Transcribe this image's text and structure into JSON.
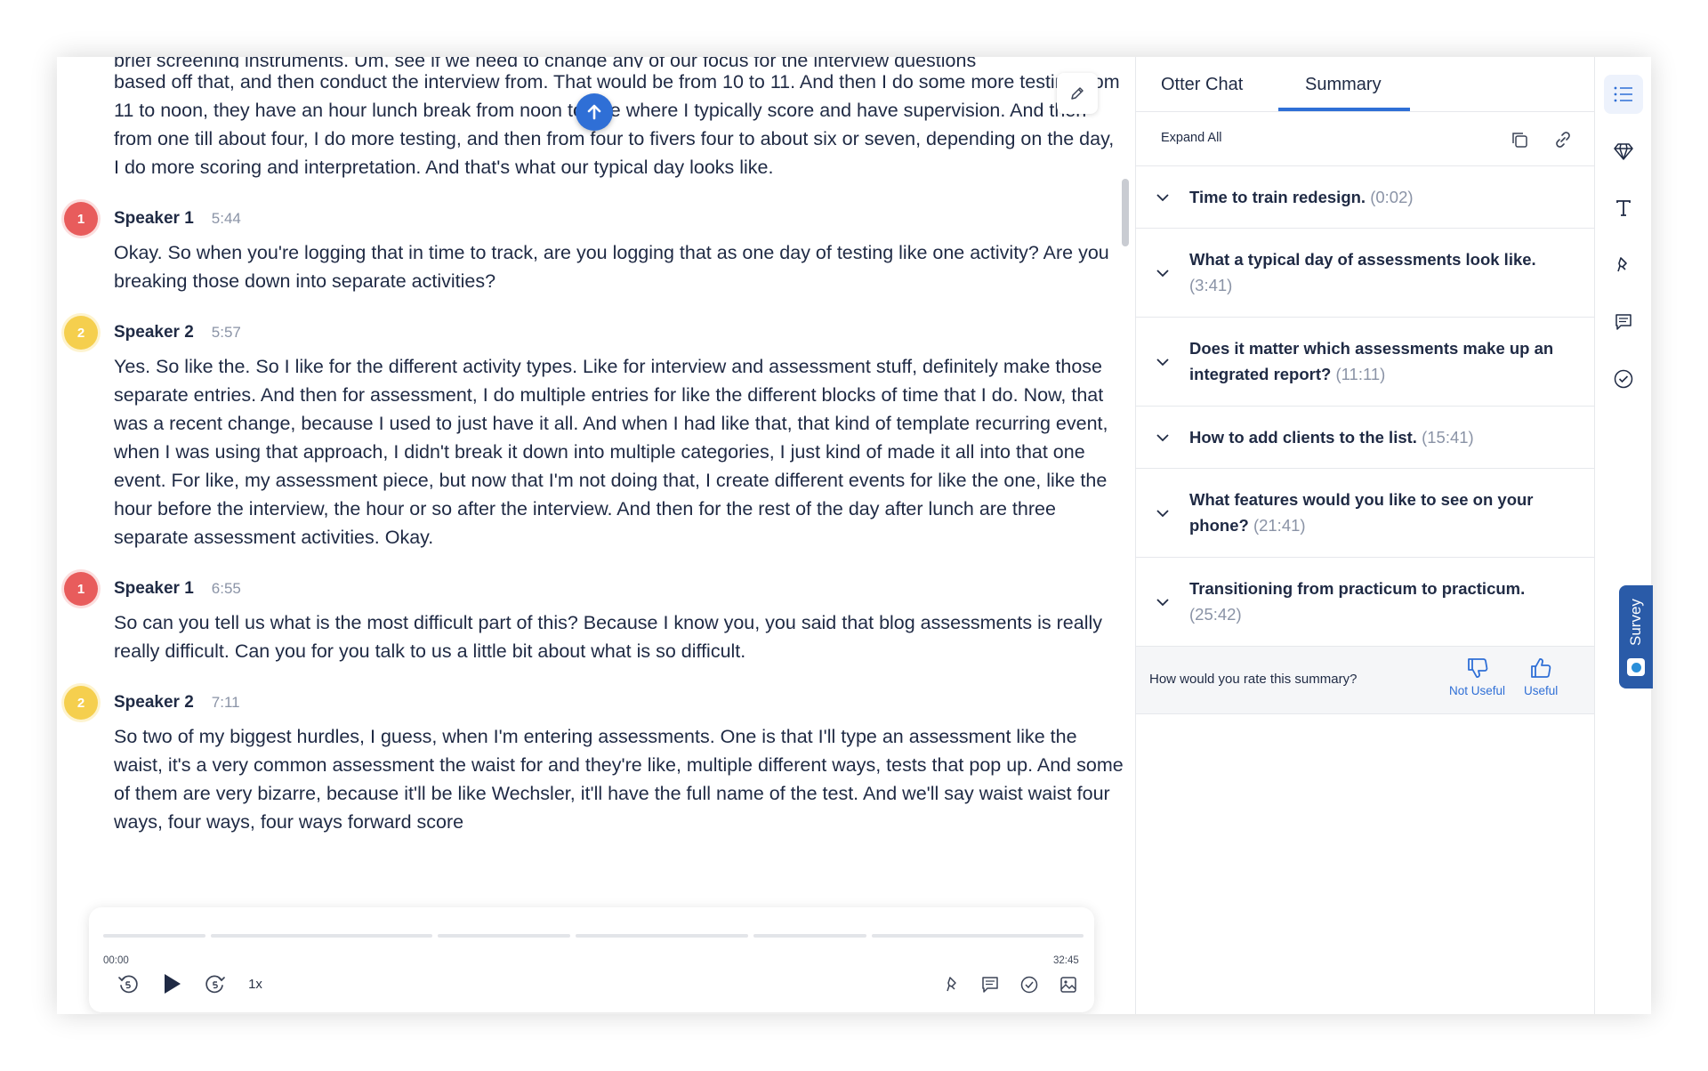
{
  "transcript": {
    "top_partial_line": "brief screening instruments. Um, see if we need to change any of our focus for the interview questions",
    "intro_paragraph": "based off that, and then conduct the interview from. That would be from 10 to 11. And then I do some more testing from 11 to noon, they have an hour lunch break from noon to one where I typically score and have supervision. And then from one till about four, I do more testing, and then from four to fivers four to about six or seven, depending on the day, I do more scoring and interpretation. And that's what our typical day looks like.",
    "blocks": [
      {
        "avatar": "1",
        "speaker": "Speaker 1",
        "time": "5:44",
        "text": "Okay. So when you're logging that in time to track, are you logging that as one day of testing like one activity? Are you breaking those down into separate activities?"
      },
      {
        "avatar": "2",
        "speaker": "Speaker 2",
        "time": "5:57",
        "text": "Yes. So like the. So I like for the different activity types. Like for interview and assessment stuff, definitely make those separate entries. And then for assessment, I do multiple entries for like the different blocks of time that I do. Now, that was a recent change, because I used to just have it all. And when I had like that, that kind of template recurring event, when I was using that approach, I didn't break it down into multiple categories, I just kind of made it all into that one event. For like, my assessment piece, but now that I'm not doing that, I create different events for like the one, like the hour before the interview, the hour or so after the interview. And then for the rest of the day after lunch are three separate assessment activities. Okay."
      },
      {
        "avatar": "1",
        "speaker": "Speaker 1",
        "time": "6:55",
        "text": "So can you tell us what is the most difficult part of this? Because I know you, you said that blog assessments is really really difficult. Can you for you talk to us a little bit about what is so difficult."
      },
      {
        "avatar": "2",
        "speaker": "Speaker 2",
        "time": "7:11",
        "text": "So two of my biggest hurdles, I guess, when I'm entering assessments. One is that I'll type an assessment like the waist, it's a very common assessment the waist for and they're like, multiple different ways, tests that pop up. And some of them are very bizarre, because it'll be like Wechsler, it'll have the full name of the test. And we'll say waist waist four ways, four ways, four ways forward score"
      }
    ]
  },
  "player": {
    "start_time": "00:00",
    "end_time": "32:45",
    "speed": "1x",
    "progress": 0.0
  },
  "panel": {
    "tabs": [
      "Otter Chat",
      "Summary"
    ],
    "active_tab": "Summary",
    "expand_all": "Expand All",
    "outline": [
      {
        "title": "Time to train redesign.",
        "ts": "(0:02)"
      },
      {
        "title": "What a typical day of assessments look like.",
        "ts": "(3:41)"
      },
      {
        "title": "Does it matter which assessments make up an integrated report?",
        "ts": "(11:11)"
      },
      {
        "title": "How to add clients to the list.",
        "ts": "(15:41)"
      },
      {
        "title": "What features would you like to see on your phone?",
        "ts": "(21:41)"
      },
      {
        "title": "Transitioning from practicum to practicum.",
        "ts": "(25:42)"
      }
    ],
    "rating": {
      "question": "How would you rate this summary?",
      "not_useful": "Not Useful",
      "useful": "Useful"
    }
  },
  "survey": {
    "label": "Survey"
  },
  "colors": {
    "accent": "#2f6fd6",
    "speaker1": "#e85c5c",
    "speaker2": "#f5cf4e",
    "text": "#1f2a44",
    "muted": "#8a93a6"
  }
}
